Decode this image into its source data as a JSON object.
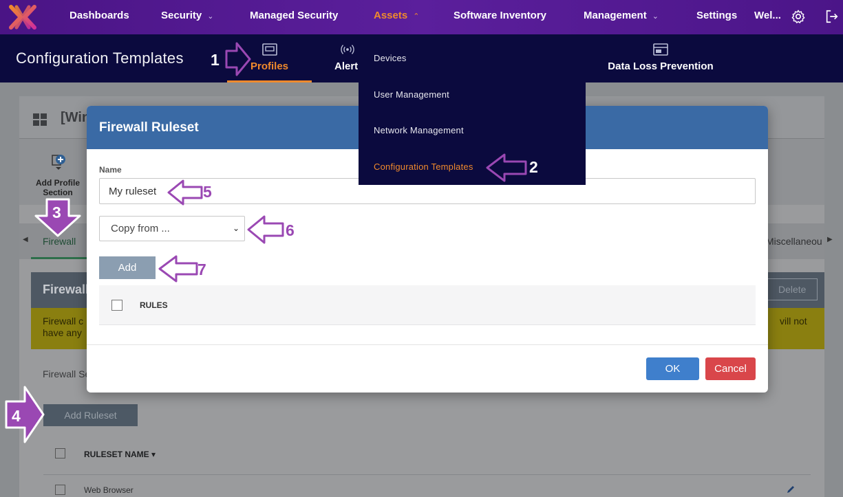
{
  "nav": {
    "items": [
      {
        "label": "Dashboards"
      },
      {
        "label": "Security"
      },
      {
        "label": "Managed Security"
      },
      {
        "label": "Assets"
      },
      {
        "label": "Software Inventory"
      },
      {
        "label": "Management"
      },
      {
        "label": "Settings"
      }
    ],
    "user_label": "Wel..."
  },
  "subheader": {
    "title": "Configuration Templates",
    "tabs": [
      {
        "label": "Profiles"
      },
      {
        "label": "Alert"
      },
      {
        "label": "Data Loss Prevention"
      }
    ]
  },
  "assets_menu": {
    "items": [
      {
        "label": "Devices"
      },
      {
        "label": "User Management"
      },
      {
        "label": "Network Management"
      },
      {
        "label": "Configuration Templates"
      }
    ]
  },
  "background": {
    "profile_title": "[Win",
    "add_profile_section": "Add Profile Section",
    "tabs": {
      "firewall": "Firewall",
      "misc": "Miscellaneou"
    },
    "firewall_header": "Firewall",
    "delete_label": "Delete",
    "warning_left_1": "Firewall c",
    "warning_left_2": "have any",
    "warning_right": "vill not",
    "firewall_settings": "Firewall Se",
    "add_ruleset": "Add Ruleset",
    "ruleset_col": "RULESET NAME",
    "rows": [
      {
        "name": "Web Browser"
      }
    ]
  },
  "modal": {
    "title": "Firewall Ruleset",
    "name_label": "Name",
    "name_value": "My ruleset",
    "copy_from": "Copy from ...",
    "add_label": "Add",
    "rules_header": "RULES",
    "ok_label": "OK",
    "cancel_label": "Cancel"
  },
  "annotations": {
    "n1": "1",
    "n2": "2",
    "n3": "3",
    "n4": "4",
    "n5": "5",
    "n6": "6",
    "n7": "7"
  },
  "colors": {
    "nav_bg": "#5b1f9c",
    "header_bg": "#0b0a3e",
    "accent_orange": "#f08a2c",
    "modal_header": "#3a6aa5",
    "ok_blue": "#3f7fcc",
    "cancel_red": "#d9464a",
    "annotation_purple": "#9a48b3"
  }
}
